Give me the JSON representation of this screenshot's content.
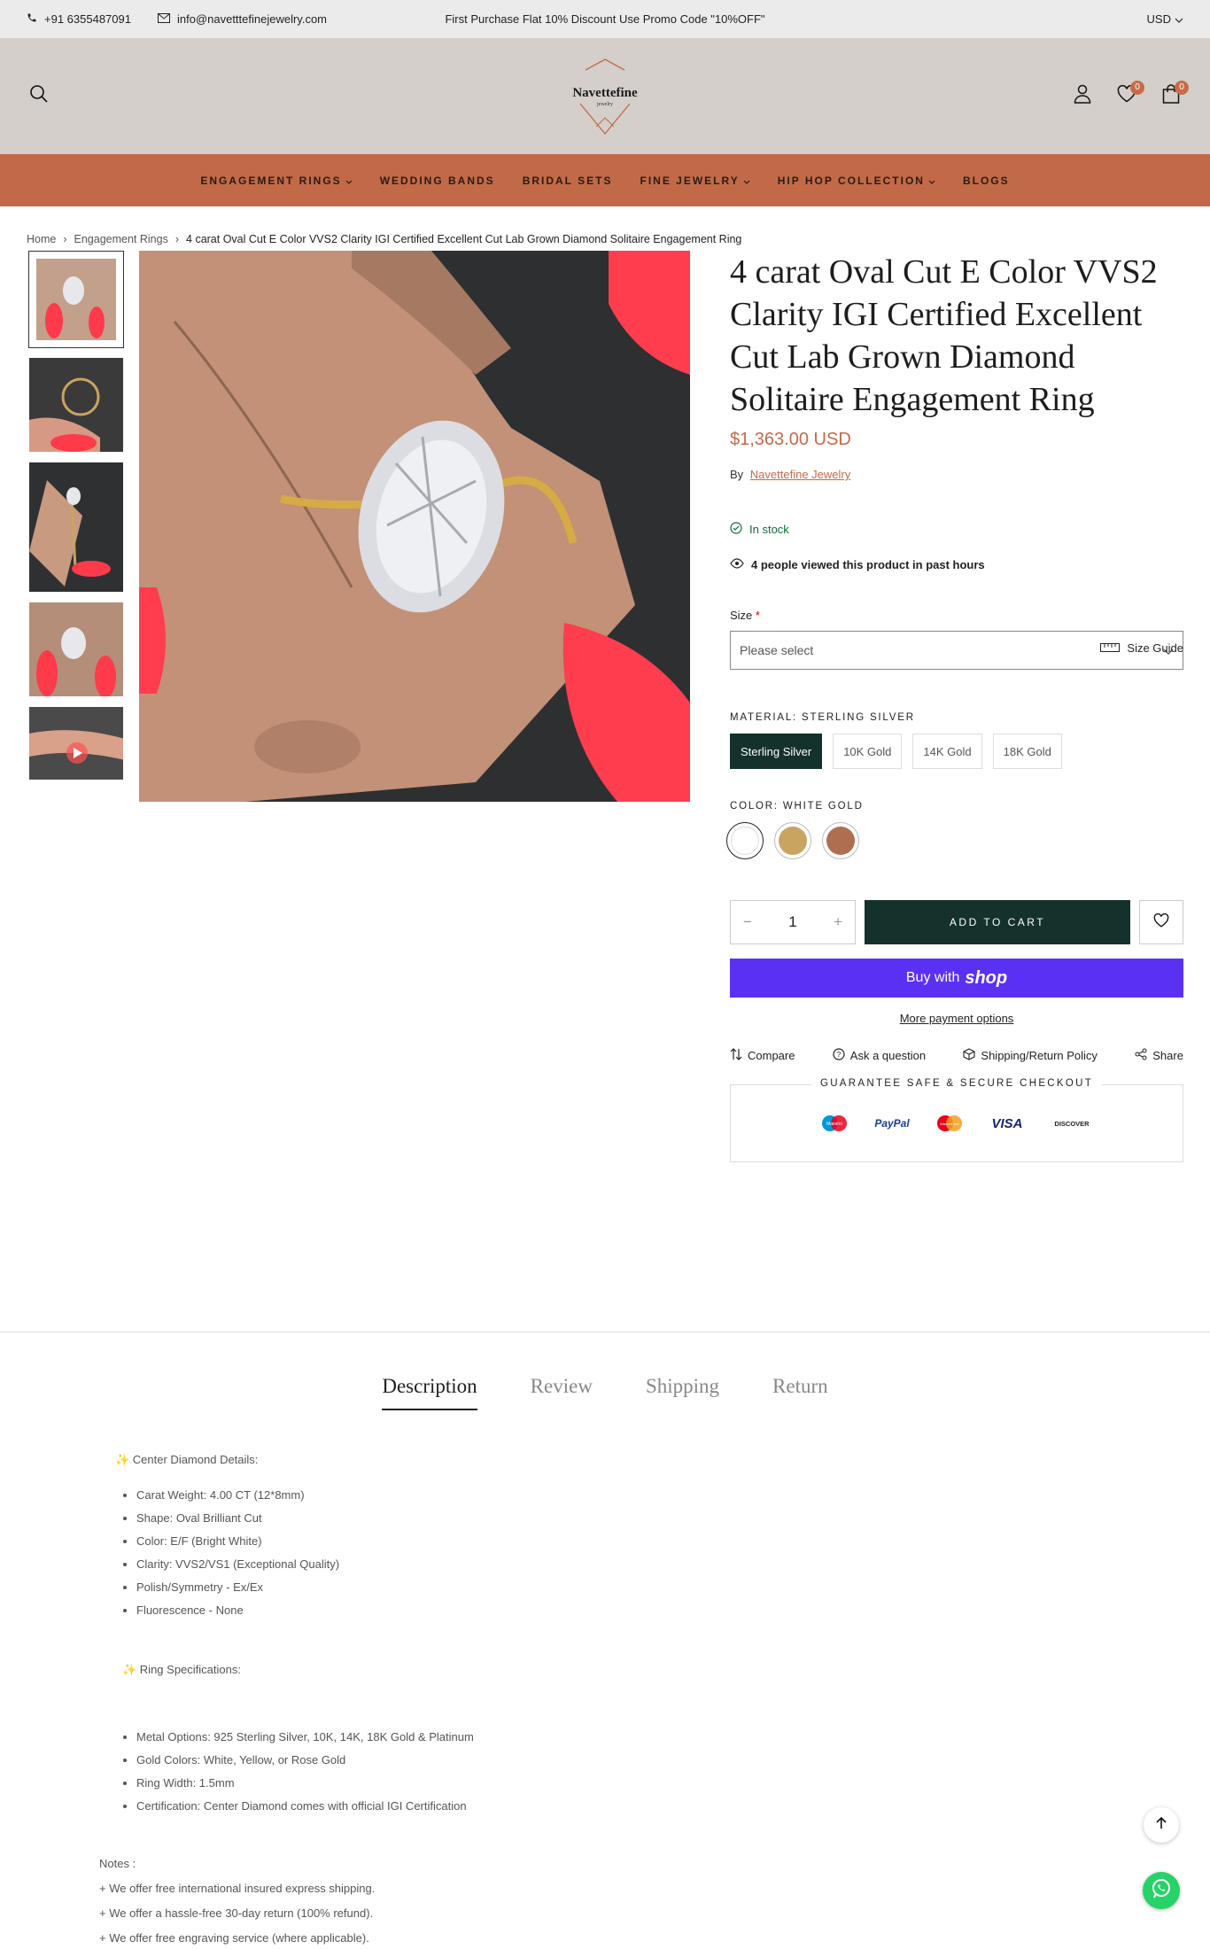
{
  "topbar": {
    "phone": "+91 6355487091",
    "email": "info@navetttefinejewelry.com",
    "promo": "First Purchase Flat 10% Discount Use Promo Code \"10%OFF\"",
    "currency": "USD"
  },
  "header": {
    "logo_text": "Navettefine",
    "logo_sub": "jewelry",
    "wishlist_count": "0",
    "cart_count": "0"
  },
  "nav": {
    "items": [
      "ENGAGEMENT RINGS",
      "WEDDING BANDS",
      "BRIDAL SETS",
      "FINE JEWELRY",
      "HIP HOP COLLECTION",
      "BLOGS"
    ]
  },
  "breadcrumb": {
    "home": "Home",
    "category": "Engagement Rings",
    "current": "4 carat Oval Cut E Color VVS2 Clarity IGI Certified Excellent Cut Lab Grown Diamond Solitaire Engagement Ring"
  },
  "product": {
    "title": "4 carat Oval Cut E Color VVS2 Clarity IGI Certified Excellent Cut Lab Grown Diamond Solitaire Engagement Ring",
    "price": "$1,363.00 USD",
    "by_label": "By",
    "vendor": "Navettefine Jewelry",
    "stock": "In stock",
    "viewed": "4 people viewed this product in past hours",
    "size_guide": "Size Guide",
    "size_label": "Size",
    "size_required": "*",
    "size_placeholder": "Please select",
    "material_label": "MATERIAL: STERLING SILVER",
    "materials": [
      "Sterling Silver",
      "10K Gold",
      "14K Gold",
      "18K Gold"
    ],
    "color_label": "COLOR: WHITE GOLD",
    "colors": [
      "#ffffff",
      "#c9a45f",
      "#b06e51"
    ],
    "quantity": "1",
    "add_to_cart": "ADD TO CART",
    "buy_with": "Buy with",
    "shop": "shop",
    "more_payment": "More payment options",
    "links": [
      "Compare",
      "Ask a question",
      "Shipping/Return Policy",
      "Share"
    ],
    "guarantee": "GUARANTEE SAFE & SECURE CHECKOUT",
    "payments": [
      "Maestro",
      "PayPal",
      "MasterCard",
      "VISA",
      "DISCOVER"
    ]
  },
  "tabs": [
    "Description",
    "Review",
    "Shipping",
    "Return"
  ],
  "description": {
    "center_heading": "✨ Center Diamond Details:",
    "center_items": [
      "Carat Weight: 4.00 CT (12*8mm)",
      "Shape: Oval Brilliant Cut",
      "Color: E/F (Bright White)",
      "Clarity: VVS2/VS1 (Exceptional Quality)",
      "Polish/Symmetry - Ex/Ex",
      "Fluorescence - None"
    ],
    "ring_heading": "✨ Ring Specifications:",
    "ring_items": [
      "Metal Options: 925 Sterling Silver, 10K, 14K, 18K Gold & Platinum",
      "Gold Colors: White, Yellow, or Rose Gold",
      "Ring Width: 1.5mm",
      "Certification: Center Diamond comes with official IGI Certification"
    ],
    "notes": [
      "Notes :",
      "+ We offer free international insured express shipping.",
      "+ We offer a hassle-free 30-day return (100% refund).",
      "+ We offer free engraving service (where applicable)."
    ]
  }
}
